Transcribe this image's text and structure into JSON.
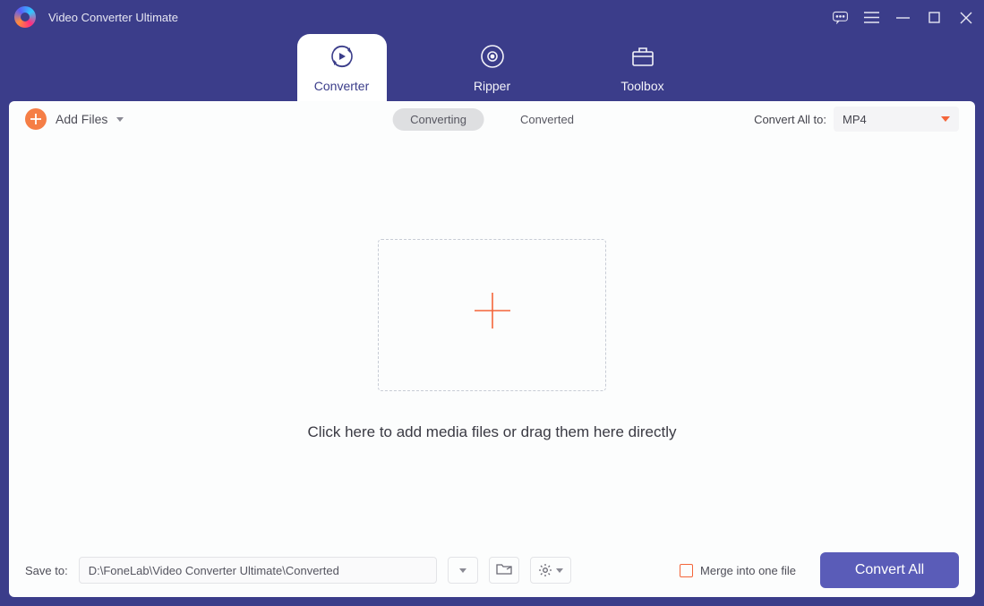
{
  "app": {
    "title": "Video Converter Ultimate"
  },
  "tabs": {
    "converter": "Converter",
    "ripper": "Ripper",
    "toolbox": "Toolbox"
  },
  "toolbar": {
    "add_files": "Add Files",
    "status_converting": "Converting",
    "status_converted": "Converted",
    "convert_all_to": "Convert All to:",
    "format": "MP4"
  },
  "dropzone": {
    "text": "Click here to add media files or drag them here directly"
  },
  "footer": {
    "save_to_label": "Save to:",
    "save_path": "D:\\FoneLab\\Video Converter Ultimate\\Converted",
    "merge_label": "Merge into one file",
    "convert_button": "Convert All"
  }
}
